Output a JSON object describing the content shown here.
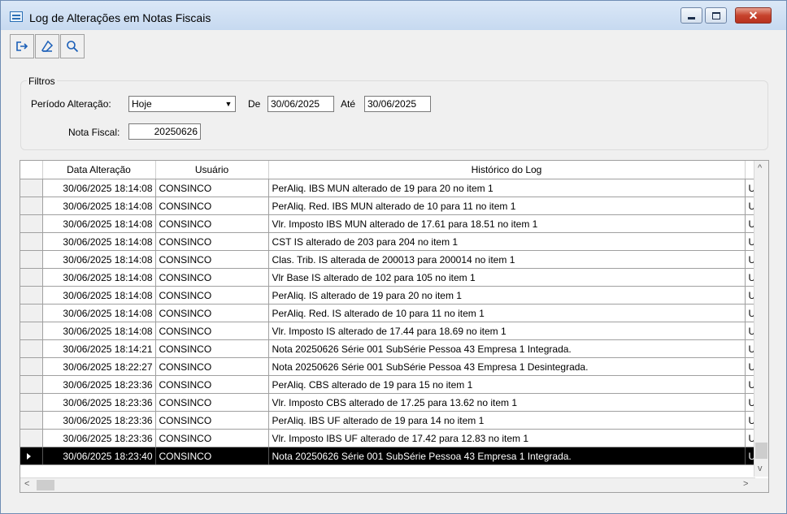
{
  "window": {
    "title": "Log de Alterações em Notas Fiscais",
    "close_glyph": "✕"
  },
  "toolbar": {
    "buttons": [
      {
        "icon": "exit-icon"
      },
      {
        "icon": "eraser-icon"
      },
      {
        "icon": "search-icon"
      }
    ]
  },
  "filters": {
    "legend": "Filtros",
    "periodo_label": "Período Alteração:",
    "periodo_value": "Hoje",
    "de_label": "De",
    "de_value": "30/06/2025",
    "ate_label": "Até",
    "ate_value": "30/06/2025",
    "nota_label": "Nota Fiscal:",
    "nota_value": "20250626"
  },
  "grid": {
    "columns": [
      "Data Alteração",
      "Usuário",
      "Histórico do Log"
    ],
    "rows": [
      {
        "date": "30/06/2025 18:14:08",
        "user": "CONSINCO",
        "log": "PerAliq. IBS MUN alterado de 19 para 20 no item 1",
        "extra": "U"
      },
      {
        "date": "30/06/2025 18:14:08",
        "user": "CONSINCO",
        "log": "PerAliq. Red. IBS MUN alterado de 10 para 11 no item 1",
        "extra": "U"
      },
      {
        "date": "30/06/2025 18:14:08",
        "user": "CONSINCO",
        "log": "Vlr. Imposto IBS MUN alterado de 17.61 para 18.51 no item 1",
        "extra": "U"
      },
      {
        "date": "30/06/2025 18:14:08",
        "user": "CONSINCO",
        "log": "CST IS alterado de 203 para 204 no item 1",
        "extra": "U"
      },
      {
        "date": "30/06/2025 18:14:08",
        "user": "CONSINCO",
        "log": "Clas. Trib. IS alterada de 200013 para 200014 no item 1",
        "extra": "U"
      },
      {
        "date": "30/06/2025 18:14:08",
        "user": "CONSINCO",
        "log": "Vlr Base IS alterado de 102 para 105 no item 1",
        "extra": "U"
      },
      {
        "date": "30/06/2025 18:14:08",
        "user": "CONSINCO",
        "log": "PerAliq. IS alterado de 19 para 20 no item 1",
        "extra": "U"
      },
      {
        "date": "30/06/2025 18:14:08",
        "user": "CONSINCO",
        "log": "PerAliq. Red. IS alterado de 10 para 11 no item 1",
        "extra": "U"
      },
      {
        "date": "30/06/2025 18:14:08",
        "user": "CONSINCO",
        "log": "Vlr. Imposto IS alterado de 17.44 para 18.69 no item 1",
        "extra": "U"
      },
      {
        "date": "30/06/2025 18:14:21",
        "user": "CONSINCO",
        "log": "Nota 20250626 Série 001 SubSérie  Pessoa 43 Empresa 1 Integrada.",
        "extra": "U"
      },
      {
        "date": "30/06/2025 18:22:27",
        "user": "CONSINCO",
        "log": "Nota 20250626 Série 001 SubSérie  Pessoa 43 Empresa 1 Desintegrada.",
        "extra": "U"
      },
      {
        "date": "30/06/2025 18:23:36",
        "user": "CONSINCO",
        "log": "PerAliq. CBS alterado de 19 para 15 no item 1",
        "extra": "U"
      },
      {
        "date": "30/06/2025 18:23:36",
        "user": "CONSINCO",
        "log": "Vlr. Imposto CBS alterado de 17.25 para 13.62 no item 1",
        "extra": "U"
      },
      {
        "date": "30/06/2025 18:23:36",
        "user": "CONSINCO",
        "log": "PerAliq. IBS UF alterado de 19 para 14 no item 1",
        "extra": "U"
      },
      {
        "date": "30/06/2025 18:23:36",
        "user": "CONSINCO",
        "log": "Vlr. Imposto IBS UF alterado de 17.42 para 12.83 no item 1",
        "extra": "U"
      },
      {
        "date": "30/06/2025 18:23:40",
        "user": "CONSINCO",
        "log": "Nota 20250626 Série 001 SubSérie  Pessoa 43 Empresa 1 Integrada.",
        "extra": "U",
        "selected": true
      }
    ]
  },
  "scroll": {
    "up": "^",
    "down": "v",
    "left": "<",
    "right": ">"
  }
}
